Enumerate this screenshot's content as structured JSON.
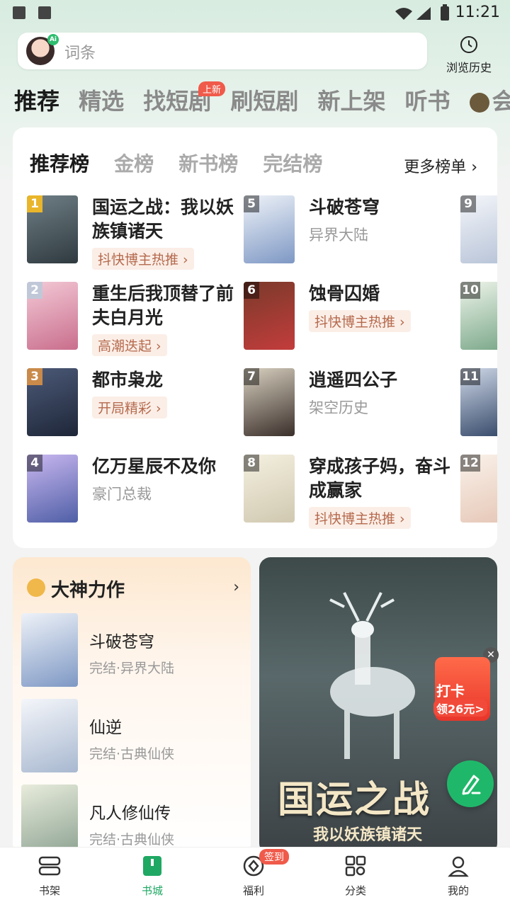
{
  "status_bar": {
    "time": "11:21"
  },
  "search": {
    "placeholder": "词条",
    "ai_badge": "Ai"
  },
  "history": {
    "label": "浏览历史"
  },
  "top_tabs": [
    "推荐",
    "精选",
    "找短剧",
    "刷短剧",
    "新上架",
    "听书",
    "会员"
  ],
  "top_tab_badge": "上新",
  "ranking": {
    "tabs": [
      "推荐榜",
      "金榜",
      "新书榜",
      "完结榜"
    ],
    "more_label": "更多榜单",
    "books": [
      {
        "rank": "1",
        "title": "国运之战：我以妖族镇诸天",
        "tag": "抖快博主热推"
      },
      {
        "rank": "2",
        "title": "重生后我顶替了前夫白月光",
        "tag": "高潮迭起"
      },
      {
        "rank": "3",
        "title": "都市枭龙",
        "tag": "开局精彩"
      },
      {
        "rank": "4",
        "title": "亿万星辰不及你",
        "sub": "豪门总裁"
      },
      {
        "rank": "5",
        "title": "斗破苍穹",
        "sub": "异界大陆"
      },
      {
        "rank": "6",
        "title": "蚀骨囚婚",
        "tag": "抖快博主热推"
      },
      {
        "rank": "7",
        "title": "逍遥四公子",
        "sub": "架空历史"
      },
      {
        "rank": "8",
        "title": "穿成孩子妈，奋斗成赢家",
        "tag": "抖快博主热推"
      },
      {
        "rank": "9"
      },
      {
        "rank": "10"
      },
      {
        "rank": "11"
      },
      {
        "rank": "12"
      }
    ]
  },
  "god_works": {
    "title": "大神力作",
    "books": [
      {
        "title": "斗破苍穹",
        "sub": "完结·异界大陆"
      },
      {
        "title": "仙逆",
        "sub": "完结·古典仙侠"
      },
      {
        "title": "凡人修仙传",
        "sub": "完结·古典仙侠"
      }
    ]
  },
  "banner": {
    "title": "国运之战",
    "subtitle": "我以妖族镇诸天"
  },
  "checkin": {
    "label": "打卡",
    "reward": "领26元>"
  },
  "bottom_nav": {
    "items": [
      "书架",
      "书城",
      "福利",
      "分类",
      "我的"
    ],
    "active": "书城",
    "welfare_badge": "签到"
  }
}
